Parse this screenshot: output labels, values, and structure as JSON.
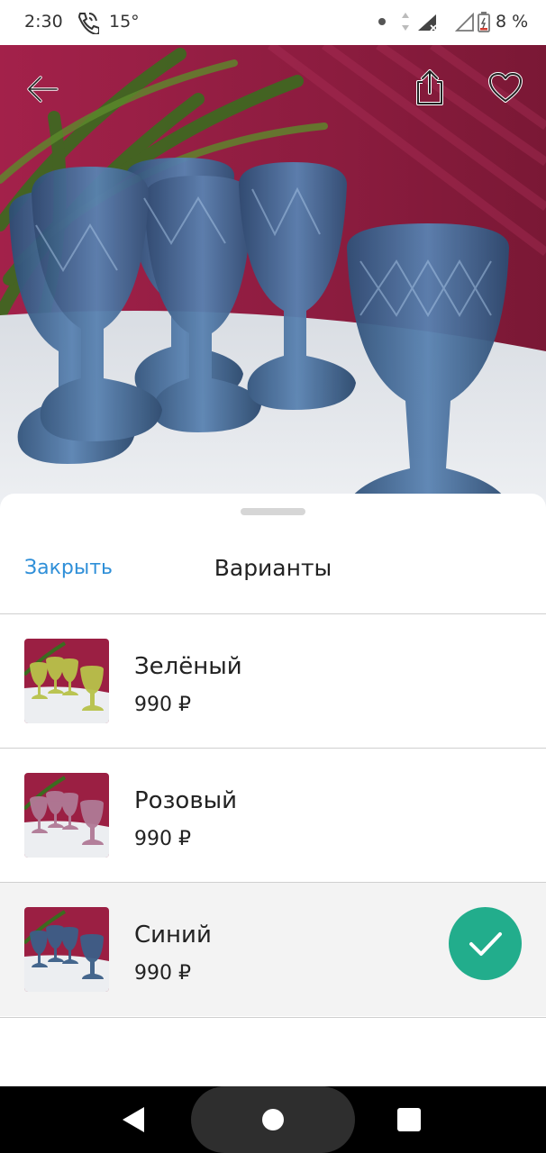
{
  "status_bar": {
    "time": "2:30",
    "temperature": "15°",
    "battery": "8 %",
    "icons": [
      "phone-call-icon",
      "dot-icon",
      "data-arrows-icon",
      "signal-icon",
      "signal-empty-icon",
      "battery-icon"
    ]
  },
  "hero": {
    "image": "blue-glass-goblets-photo",
    "icons": [
      "back-arrow-icon",
      "share-icon",
      "heart-icon"
    ]
  },
  "sheet": {
    "close_label": "Закрыть",
    "title": "Варианты",
    "variants": [
      {
        "name": "Зелёный",
        "price": "990 ₽",
        "selected": false,
        "glass_color": "#b8c24a"
      },
      {
        "name": "Розовый",
        "price": "990 ₽",
        "selected": false,
        "glass_color": "#b07a96"
      },
      {
        "name": "Синий",
        "price": "990 ₽",
        "selected": true,
        "glass_color": "#3c5f88"
      }
    ]
  },
  "colors": {
    "accent_link": "#2f8fd8",
    "selected_check": "#22ad8c",
    "selected_row_bg": "#f3f3f3",
    "hero_background": "#8a1e3f"
  },
  "nav_bar": {
    "icons": [
      "nav-back-icon",
      "nav-home-icon",
      "nav-recents-icon"
    ]
  }
}
